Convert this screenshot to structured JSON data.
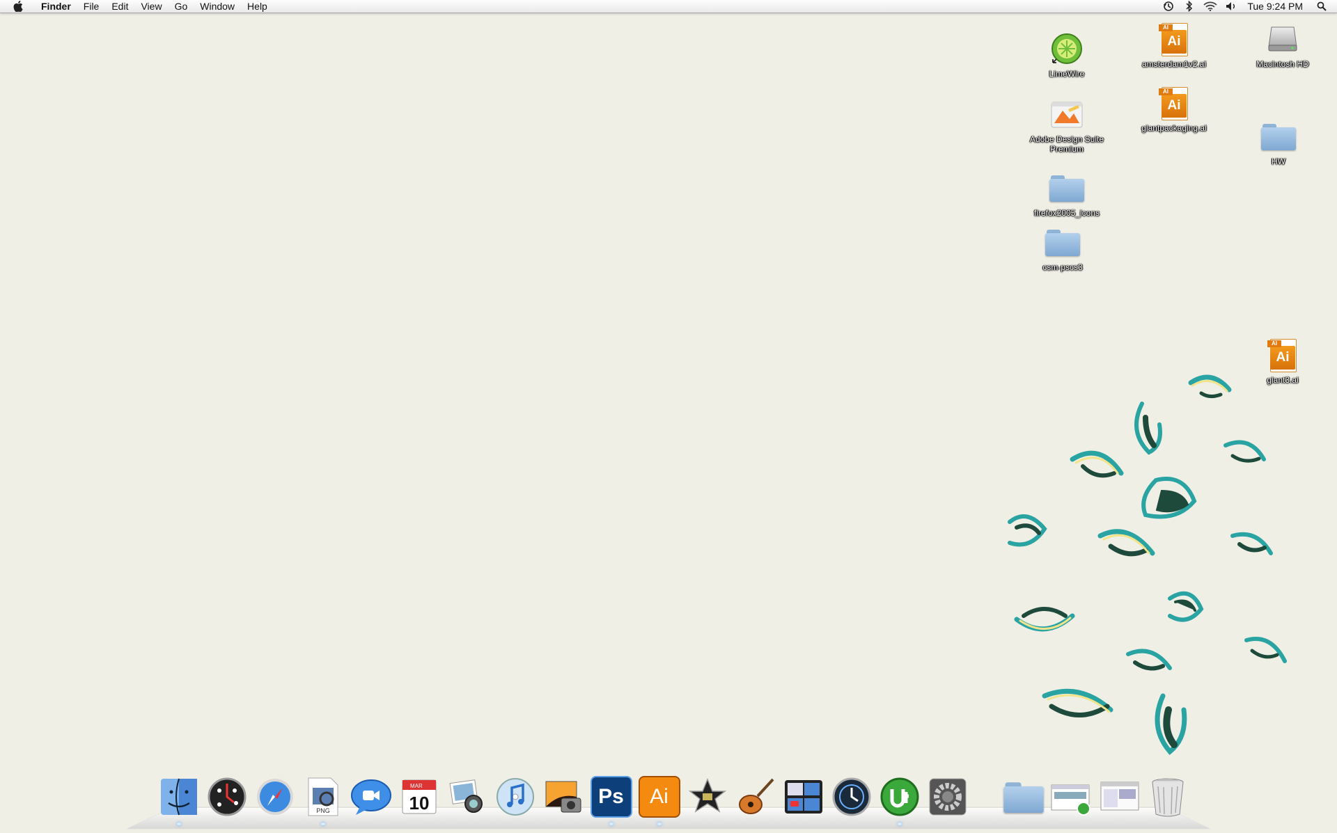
{
  "menubar": {
    "app_name": "Finder",
    "menus": [
      "File",
      "Edit",
      "View",
      "Go",
      "Window",
      "Help"
    ],
    "clock": "Tue 9:24 PM",
    "status_icons": [
      "time-machine-icon",
      "bluetooth-icon",
      "wifi-icon",
      "volume-icon",
      "spotlight-icon"
    ]
  },
  "desktop_icons": {
    "limewire": "LimeWire",
    "adobe_suite": "Adobe Design Suite Premium",
    "firefox_icons": "firefox2005_icons",
    "csm_pscs3": "csm-pscs3",
    "amsterdam": "amsterdam1v2.ai",
    "giantpackaging": "giantpackaging.ai",
    "macintosh_hd": "Macintosh HD",
    "hw": "HW",
    "giant3": "giant3.ai"
  },
  "ai_badge": "Ai",
  "ai_tag": "AI",
  "dock": {
    "calendar_month": "MAR",
    "calendar_day": "10",
    "png_label": "PNG",
    "ps_label": "Ps",
    "ai_label": "Ai",
    "items": [
      "finder-icon",
      "dashboard-icon",
      "safari-icon",
      "preview-icon",
      "ichat-icon",
      "ical-icon",
      "iphoto-icon",
      "itunes-icon",
      "image-capture-icon",
      "photoshop-icon",
      "illustrator-icon",
      "imovie-icon",
      "garageband-icon",
      "spaces-icon",
      "time-machine-icon",
      "utorrent-icon",
      "system-preferences-icon",
      "documents-stack-icon",
      "downloads-stack-icon",
      "screenshots-stack-icon",
      "trash-icon"
    ]
  },
  "colors": {
    "desktop_bg": "#f0efe6",
    "wallpaper_teal": "#2aa3a3",
    "wallpaper_dark": "#1e4a3c",
    "wallpaper_yellow": "#f2e48a"
  }
}
